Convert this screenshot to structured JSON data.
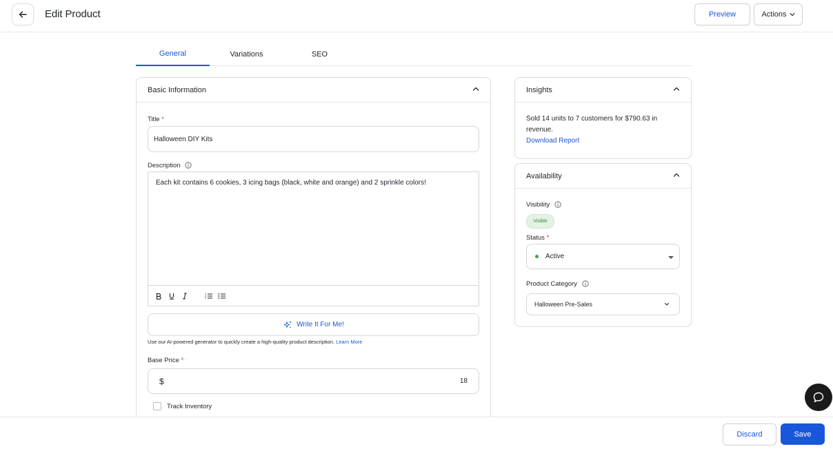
{
  "header": {
    "title": "Edit Product",
    "preview_label": "Preview",
    "actions_label": "Actions"
  },
  "tabs": [
    {
      "label": "General",
      "active": true
    },
    {
      "label": "Variations",
      "active": false
    },
    {
      "label": "SEO",
      "active": false
    }
  ],
  "basic_info": {
    "heading": "Basic Information",
    "title_label": "Title",
    "title_value": "Halloween DIY Kits",
    "description_label": "Description",
    "description_value": "Each kit contains 6 cookies, 3 icing bags (black, white and orange) and 2 sprinkle colors!",
    "toolbar": [
      "bold-icon",
      "underline-icon",
      "italic-icon",
      "ordered-list-icon",
      "bullet-list-icon"
    ],
    "ai_button_label": "Write It For Me!",
    "ai_note": "Use our AI-powered generator to quickly create a high-quality product description.",
    "ai_learn_more": "Learn More",
    "base_price_label": "Base Price",
    "currency_symbol": "$",
    "base_price_value": "18",
    "track_inventory_label": "Track Inventory",
    "track_inventory_checked": false
  },
  "insights": {
    "heading": "Insights",
    "summary": "Sold 14 units to 7 customers for $790.63 in revenue.",
    "download_label": "Download Report"
  },
  "availability": {
    "heading": "Availability",
    "visibility_label": "Visibility",
    "visibility_badge": "Visible",
    "status_label": "Status",
    "status_value": "Active",
    "category_label": "Product Category",
    "category_value": "Halloween Pre-Sales"
  },
  "footer": {
    "discard_label": "Discard",
    "save_label": "Save"
  },
  "colors": {
    "accent": "#1a56db",
    "required": "#d32f2f",
    "status_active": "#3fa34d"
  }
}
